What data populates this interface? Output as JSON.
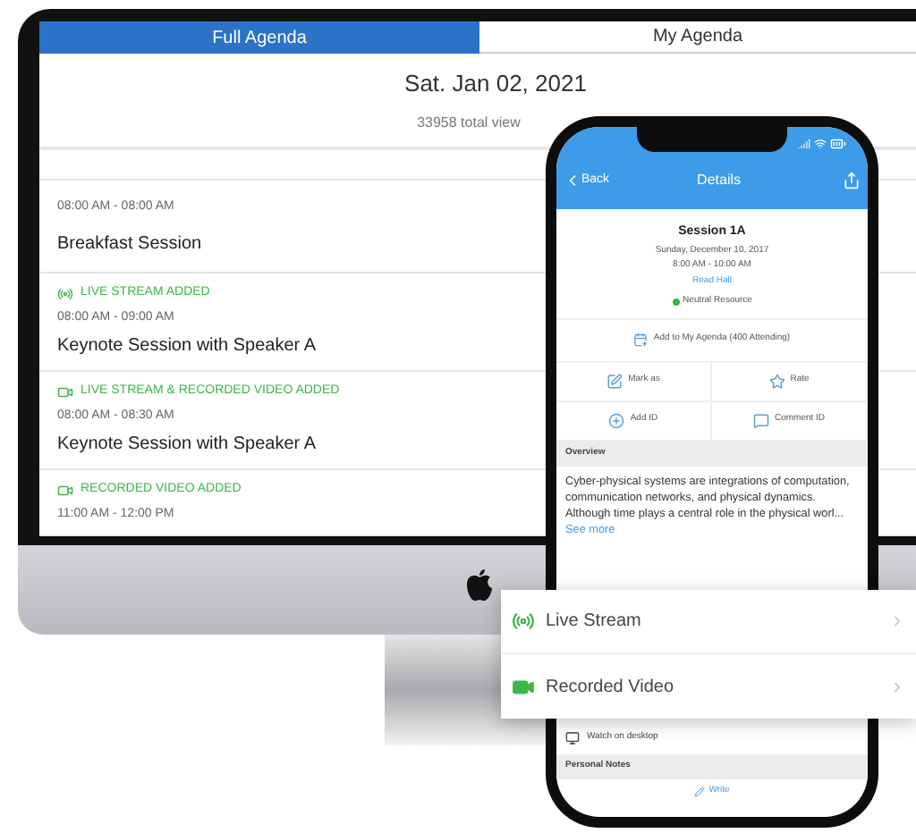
{
  "desktop": {
    "tabs": [
      {
        "label": "Full Agenda",
        "selected": true
      },
      {
        "label": "My Agenda",
        "selected": false
      }
    ],
    "date": "Sat. Jan 02, 2021",
    "views": "33958 total view",
    "sessions": [
      {
        "kind": "plain",
        "time": "08:00 AM - 08:00 AM",
        "title": "Breakfast Session"
      },
      {
        "kind": "live",
        "badge": "LIVE STREAM ADDED",
        "time": "08:00 AM - 09:00 AM",
        "title": "Keynote Session with Speaker A"
      },
      {
        "kind": "both",
        "badge": "LIVE STREAM & RECORDED VIDEO ADDED",
        "time": "08:00 AM - 08:30 AM",
        "title": "Keynote Session with Speaker A"
      },
      {
        "kind": "recorded",
        "badge": "RECORDED VIDEO ADDED",
        "time": "11:00 AM - 12:00 PM"
      }
    ]
  },
  "phone": {
    "back": "Back",
    "title": "Details",
    "session": "Session 1A",
    "date": "Sunday, December 10, 2017",
    "time": "8:00 AM - 10:00 AM",
    "room": "Read Hall",
    "tag": "Neutral Resource",
    "add": "Add to My Agenda (400 Attending)",
    "actions": [
      {
        "kind": "mark",
        "label": "Mark as"
      },
      {
        "kind": "rate",
        "label": "Rate"
      },
      {
        "kind": "add",
        "label": "Add ID"
      },
      {
        "kind": "comment",
        "label": "Comment ID"
      }
    ],
    "overview_heading": "Overview",
    "overview": "Cyber-physical systems are integrations of computation, communication networks, and physical dynamics. Although time plays a central role in the physical worl...",
    "see_more": "See more",
    "watch": "Watch on desktop",
    "notes_heading": "Personal Notes",
    "write": "Write"
  },
  "popup": {
    "options": [
      {
        "kind": "live",
        "label": "Live Stream"
      },
      {
        "kind": "recorded",
        "label": "Recorded Video"
      }
    ]
  }
}
